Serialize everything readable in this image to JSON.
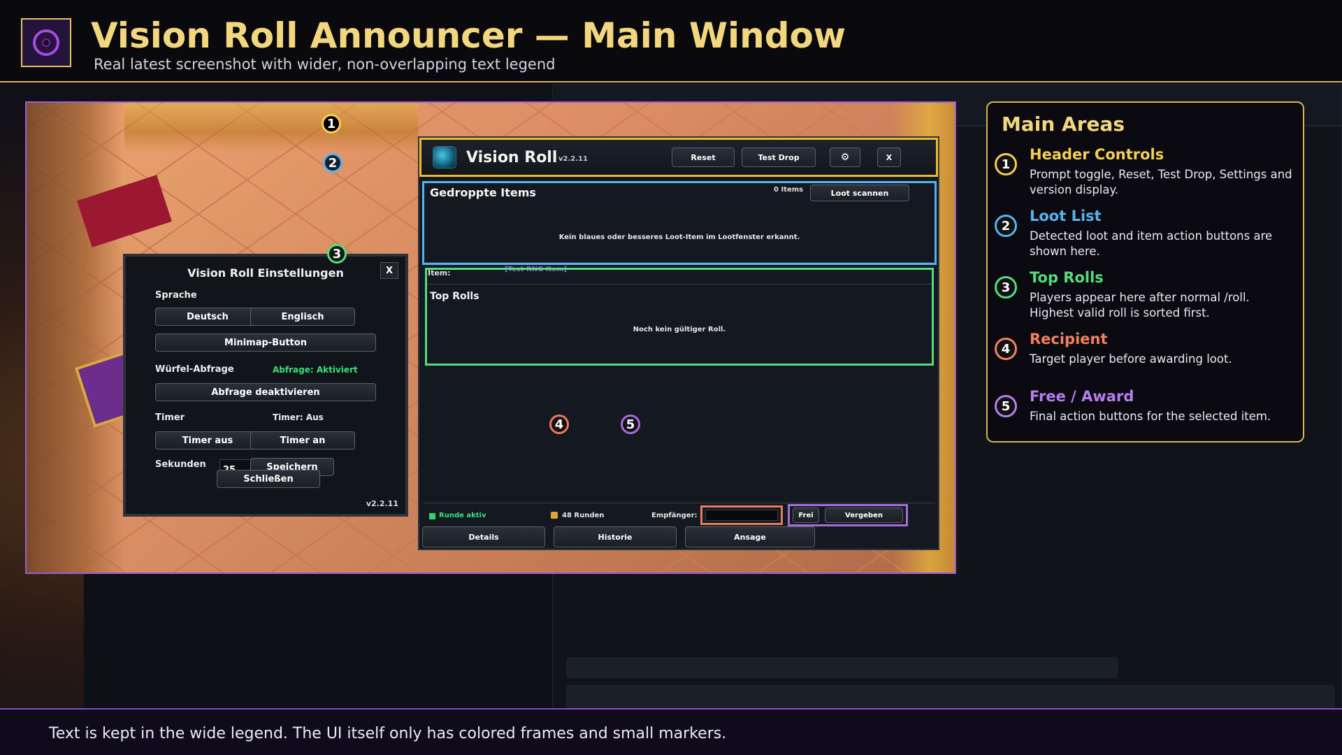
{
  "header": {
    "title": "Vision Roll Announcer — Main Window",
    "subtitle": "Real latest screenshot with wider, non-overlapping text legend",
    "logo_icon": "vision-eye-icon"
  },
  "settings": {
    "title": "Vision Roll Einstellungen",
    "close_label": "X",
    "sprache_label": "Sprache",
    "btn_deutsch": "Deutsch",
    "btn_englisch": "Englisch",
    "btn_minimap": "Minimap-Button",
    "wuerfel_label": "Würfel-Abfrage",
    "wuerfel_status": "Abfrage: Aktiviert",
    "btn_abfrage": "Abfrage deaktivieren",
    "timer_label": "Timer",
    "timer_status": "Timer: Aus",
    "btn_timer_aus": "Timer aus",
    "btn_timer_an": "Timer an",
    "sekunden_label": "Sekunden",
    "sekunden_value": "25",
    "btn_speichern": "Speichern",
    "btn_schliessen": "Schließen",
    "version": "v2.2.11"
  },
  "main_window": {
    "title": "Vision Roll",
    "version": "v2.2.11",
    "btn_reset": "Reset",
    "btn_test_drop": "Test Drop",
    "settings_icon": "gear-icon",
    "btn_close": "X",
    "loot": {
      "title": "Gedroppte Items",
      "count": "0 Items",
      "btn_scan": "Loot scannen",
      "empty": "Kein blaues oder besseres Loot-Item im Lootfenster erkannt."
    },
    "item_label": "Item:",
    "item_value": "[Test RNG Item]",
    "rolls": {
      "title": "Top Rolls",
      "empty": "Noch kein gültiger Roll."
    },
    "status": {
      "round": "Runde aktiv",
      "rounds_count": "48 Runden",
      "recipient_label": "Empfänger:",
      "recipient_value": ""
    },
    "btn_frei": "Frei",
    "btn_vergeben": "Vergeben",
    "btn_details": "Details",
    "btn_historie": "Historie",
    "btn_ansage": "Ansage"
  },
  "markers": [
    "1",
    "2",
    "3",
    "4",
    "5"
  ],
  "legend": {
    "title": "Main Areas",
    "items": [
      {
        "num": "1",
        "title": "Header Controls",
        "desc": "Prompt toggle, Reset, Test Drop, Settings and version display.",
        "color": "#f5cf4e"
      },
      {
        "num": "2",
        "title": "Loot List",
        "desc": "Detected loot and item action buttons are shown here.",
        "color": "#57b3f0"
      },
      {
        "num": "3",
        "title": "Top Rolls",
        "desc": "Players appear here after normal /roll. Highest valid roll is sorted first.",
        "color": "#55dd7c"
      },
      {
        "num": "4",
        "title": "Recipient",
        "desc": "Target player before awarding loot.",
        "color": "#f2805f"
      },
      {
        "num": "5",
        "title": "Free / Award",
        "desc": "Final action buttons for the selected item.",
        "color": "#b77ef0"
      }
    ]
  },
  "footer": {
    "text": "Text is kept in the wide legend. The UI itself only has colored frames and small markers."
  },
  "colors": {
    "gold": "#f3d77e",
    "header_frame": "#ebbb2e",
    "loot_frame": "#57b3f0",
    "rolls_frame": "#55dd7c",
    "recipient_frame": "#e77a5e",
    "award_frame": "#a66bd8"
  }
}
